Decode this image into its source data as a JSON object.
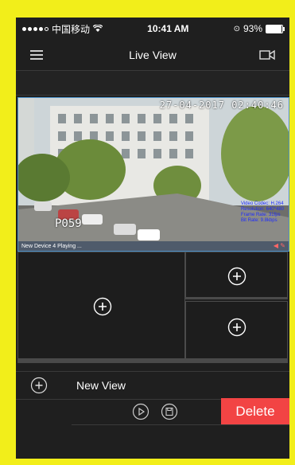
{
  "status_bar": {
    "carrier": "中国移动",
    "time": "10:41 AM",
    "battery_text": "93%",
    "battery_level": 0.93
  },
  "nav": {
    "title": "Live View",
    "left_icon": "menu-icon",
    "right_icon": "camera-icon"
  },
  "video": {
    "timestamp": "27-04-2017  02:40:46",
    "plate": "P059",
    "info_lines": [
      "Video Codec: H.264",
      "Resolution: 640*480",
      "Frame Rate: 31fps",
      "Bit Rate: 9.8kbps"
    ],
    "status": "New Device 4  Playing ..."
  },
  "grid": {
    "cells": [
      "add-camera-icon",
      "add-camera-icon",
      "add-camera-icon"
    ]
  },
  "view_list": {
    "item_label": "New View",
    "delete_label": "Delete",
    "action_icons": [
      "play-icon",
      "save-icon"
    ]
  },
  "colors": {
    "background": "#f2ee1a",
    "delete": "#f24444",
    "video_border": "#4a90c8"
  }
}
